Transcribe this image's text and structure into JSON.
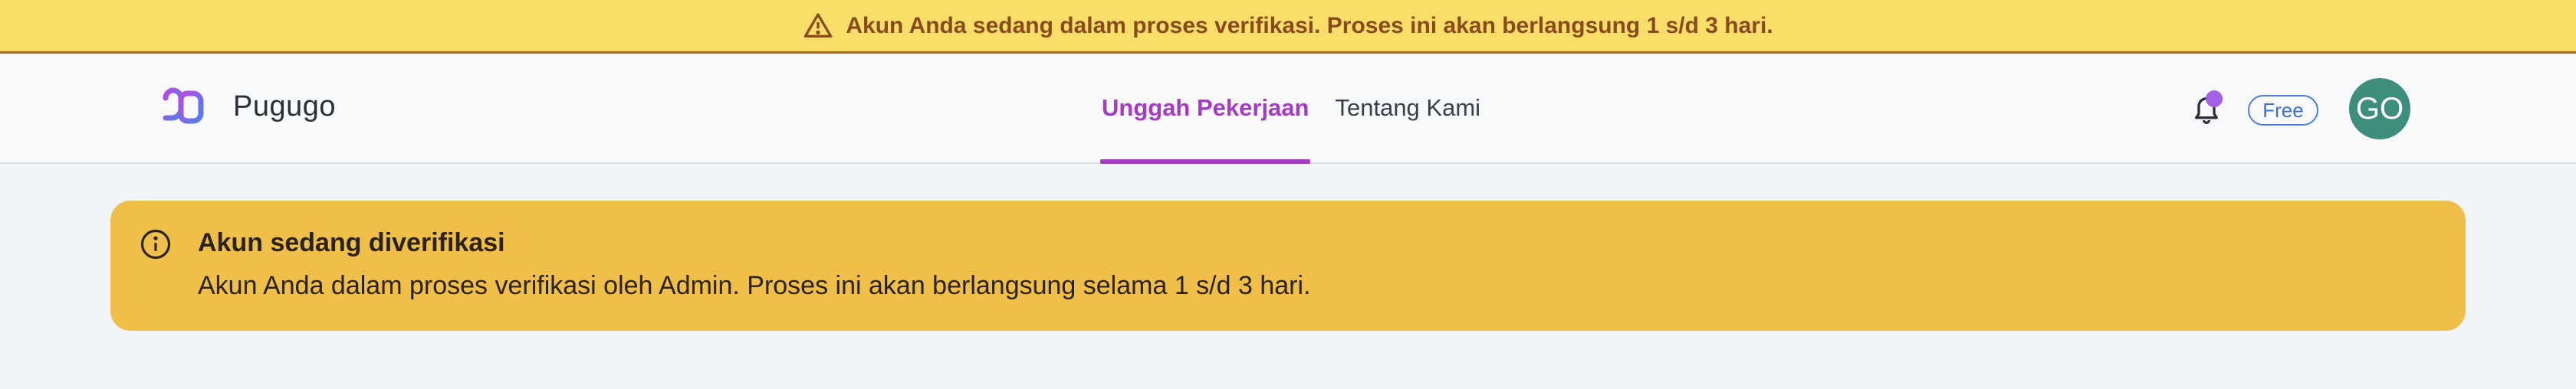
{
  "top_banner": {
    "icon": "warning-triangle-icon",
    "text": "Akun Anda sedang dalam proses verifikasi. Proses ini akan berlangsung 1 s/d 3 hari."
  },
  "navbar": {
    "brand": "Pugugo",
    "tabs": [
      {
        "label": "Unggah Pekerjaan",
        "active": true
      },
      {
        "label": "Tentang Kami",
        "active": false
      }
    ],
    "notification_icon": "bell-icon",
    "plan_badge": "Free",
    "avatar_initials": "GO"
  },
  "alert": {
    "icon": "info-icon",
    "title": "Akun sedang diverifikasi",
    "text": "Akun Anda dalam proses verifikasi oleh Admin. Proses ini akan berlangsung selama 1 s/d 3 hari."
  },
  "colors": {
    "banner_bg": "#f9df69",
    "accent": "#a53ac3",
    "alert_bg": "#efbf4a",
    "avatar_bg": "#3d8e7c"
  }
}
